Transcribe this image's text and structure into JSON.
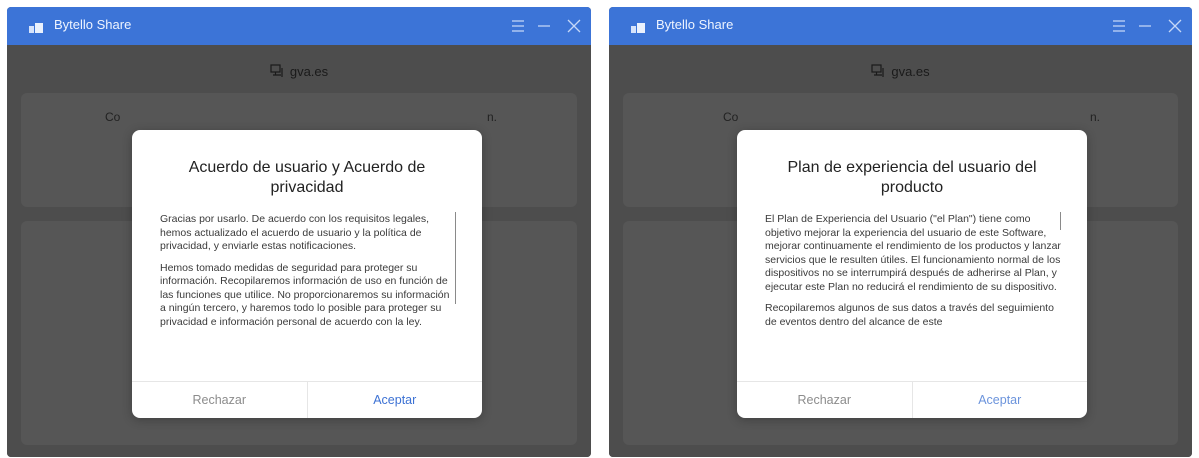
{
  "windows": [
    {
      "app_title": "Bytello Share",
      "domain": "gva.es",
      "peek_left": "Co",
      "peek_right": "n.",
      "dialog": {
        "title": "Acuerdo de usuario y Acuerdo de privacidad",
        "paragraphs": [
          "Gracias por usarlo. De acuerdo con los requisitos legales, hemos actualizado el acuerdo de usuario y la política de privacidad, y enviarle estas notificaciones.",
          "Hemos tomado medidas de seguridad para proteger su información. Recopilaremos información de uso en función de las funciones que utilice. No proporcionaremos su información a ningún tercero, y haremos todo lo posible para proteger su privacidad e información personal de acuerdo con la ley."
        ],
        "reject_label": "Rechazar",
        "accept_label": "Aceptar"
      }
    },
    {
      "app_title": "Bytello Share",
      "domain": "gva.es",
      "peek_left": "Co",
      "peek_right": "n.",
      "dialog": {
        "title": "Plan de experiencia del usuario del producto",
        "paragraphs": [
          "El Plan de Experiencia del Usuario (\"el Plan\") tiene como objetivo mejorar la experiencia del usuario de este Software, mejorar continuamente el rendimiento de los productos y lanzar servicios que le resulten útiles. El funcionamiento normal de los dispositivos no se interrumpirá después de adherirse al Plan, y ejecutar este Plan no reducirá el rendimiento de su dispositivo.",
          "Recopilaremos algunos de sus datos a través del seguimiento de eventos dentro del alcance de este"
        ],
        "reject_label": "Rechazar",
        "accept_label": "Aceptar"
      }
    }
  ],
  "colors": {
    "titlebar": "#3c74d7",
    "overlay": "#4d4d4d",
    "accept": "#3d72d4",
    "reject": "#8c8c8c"
  },
  "icons": {
    "app": "app-logo-icon",
    "domain": "network-share-icon",
    "menu": "menu-icon",
    "minimize": "minimize-icon",
    "close": "close-icon"
  }
}
